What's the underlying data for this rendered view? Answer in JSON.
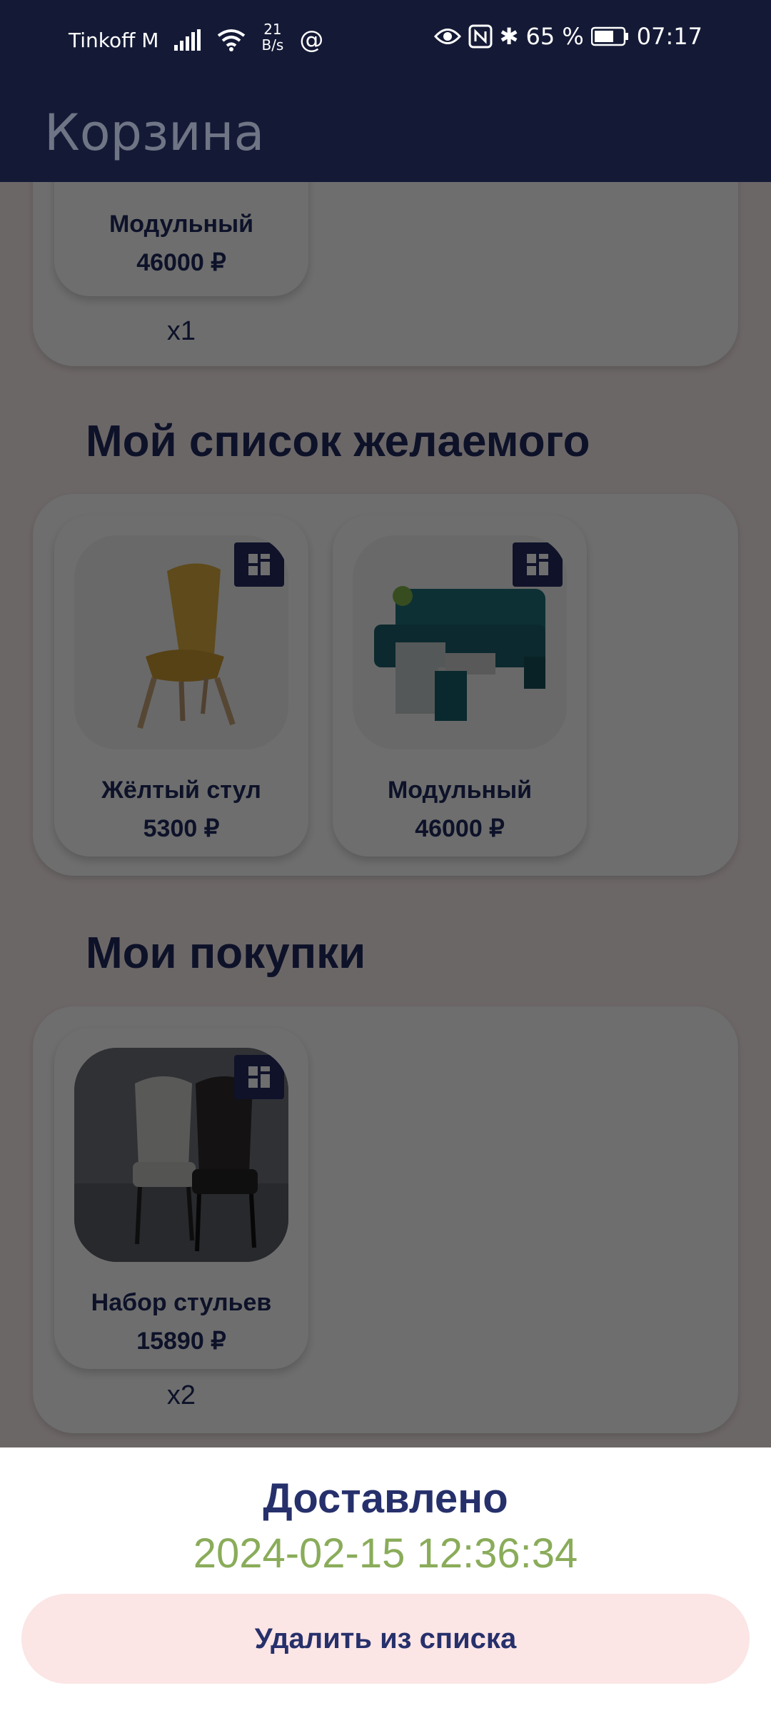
{
  "status_bar": {
    "carrier": "Tinkoff M",
    "net_speed_value": "21",
    "net_speed_unit": "B/s",
    "battery_percent": "65 %",
    "time": "07:17"
  },
  "app_bar": {
    "title": "Корзина"
  },
  "cart": {
    "partial_item": {
      "name": "Модульный",
      "price": "46000 ₽",
      "qty": "x1"
    }
  },
  "wishlist": {
    "title": "Мой список желаемого",
    "items": [
      {
        "name": "Жёлтый стул",
        "price": "5300 ₽"
      },
      {
        "name": "Модульный",
        "price": "46000 ₽"
      }
    ]
  },
  "purchases": {
    "title": "Мои покупки",
    "items": [
      {
        "name": "Набор стульев",
        "price": "15890 ₽",
        "qty": "x2"
      }
    ]
  },
  "sheet": {
    "status": "Доставлено",
    "date": "2024-02-15 12:36:34",
    "delete_label": "Удалить из списка"
  },
  "colors": {
    "header_bg": "#141a36",
    "accent_text": "#1f2a60",
    "date_green": "#8aac5a",
    "button_bg": "#fbe5e5"
  }
}
